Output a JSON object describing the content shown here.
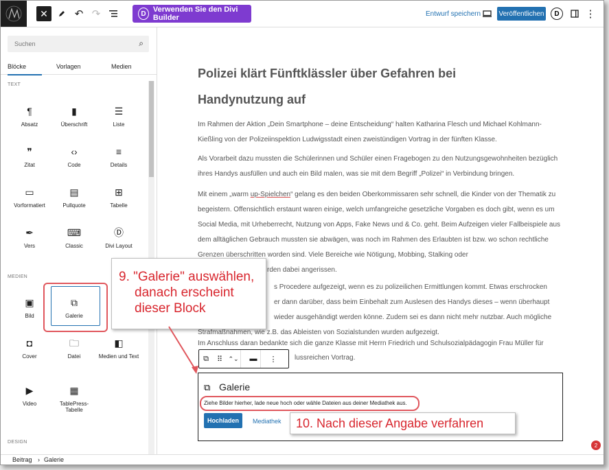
{
  "topbar": {
    "divi_button_label": "Verwenden Sie den Divi Builder",
    "divi_letter": "D",
    "save_draft": "Entwurf speichern",
    "publish": "Veröffentlichen",
    "divi_badge": "D"
  },
  "sidebar": {
    "search_placeholder": "Suchen",
    "tabs": [
      "Blöcke",
      "Vorlagen",
      "Medien"
    ],
    "sections": {
      "text": "TEXT",
      "media": "MEDIEN",
      "design": "DESIGN"
    },
    "text_blocks": [
      "Absatz",
      "Überschrift",
      "Liste",
      "Zitat",
      "Code",
      "Details",
      "Vorformatiert",
      "Pullquote",
      "Tabelle",
      "Vers",
      "Classic",
      "Divi Layout"
    ],
    "media_blocks": [
      "Bild",
      "Galerie",
      "",
      "Cover",
      "Datei",
      "Medien und Text",
      "Video",
      "TablePress-Tabelle"
    ]
  },
  "editor": {
    "title": "Polizei klärt Fünftklässler über Gefahren bei Handynutzung auf",
    "p1": "Im Rahmen der Aktion „Dein Smartphone – deine Entscheidung“ halten Katharina Flesch und Michael Kohlmann-Kießling von der Polizeiinspektion Ludwigsstadt einen zweistündigen Vortrag in der fünften Klasse.",
    "p2": "Als Vorarbeit dazu mussten die Schülerinnen und Schüler einen Fragebogen zu den Nutzungsgewohnheiten bezüglich ihres Handys ausfüllen und auch ein Bild malen, was sie mit dem Begriff „Polizei“ in Verbindung bringen.",
    "p3_a": "Mit einem „warm ",
    "p3_ul": "up-Spielchen",
    "p3_b": "“ gelang es den beiden Oberkommissaren sehr schnell, die Kinder von der Thematik zu begeistern. Offensichtlich erstaunt waren einige, welch umfangreiche gesetzliche Vorgaben es doch gibt, wenn es um Social Media, mit Urheberrecht, Nutzung von Apps, Fake News und & Co. geht. Beim Aufzeigen vieler Fallbeispiele aus dem alltäglichen Gebrauch mussten sie abwägen, was noch im Rahmen des Erlaubten ist bzw. wo schon rechtliche Grenzen überschritten worden sind. Viele Bereiche wie Nötigung, Mobbing, Stalking oder",
    "p3_c": "rden dabei angerissen.",
    "p4_l1": "s Procedere aufgezeigt, wenn es zu polizeilichen Ermittlungen kommt. Etwas erschrocken",
    "p4_l2": "er dann darüber, dass beim Einbehalt zum Auslesen des Handys dieses – wenn überhaupt",
    "p4_l3": "wieder ausgehändigt werden könne. Zudem sei es dann nicht mehr nutzbar. Auch mögliche",
    "p4_l4": "Strafmaßnahmen, wie z.B. das Ableisten von Sozialstunden wurden aufgezeigt.",
    "p5_l1": "Im Anschluss daran bedankte sich die ganze Klasse mit Herrn Friedrich und Schulsozialpädagogin Frau Müller für",
    "p5_l2": "lussreichen Vortrag.",
    "gallery": {
      "title": "Galerie",
      "instructions": "Ziehe Bilder hierher, lade neue hoch oder wähle Dateien aus deiner Mediathek aus.",
      "upload": "Hochladen",
      "library": "Mediathek"
    }
  },
  "footer": {
    "crumb1": "Beitrag",
    "sep": "›",
    "crumb2": "Galerie"
  },
  "callouts": {
    "step9_l1": "9. \"Galerie\" auswählen,",
    "step9_l2": "danach erscheint",
    "step9_l3": "dieser Block",
    "step10": "10. Nach dieser Angabe verfahren"
  },
  "notification_count": "2"
}
